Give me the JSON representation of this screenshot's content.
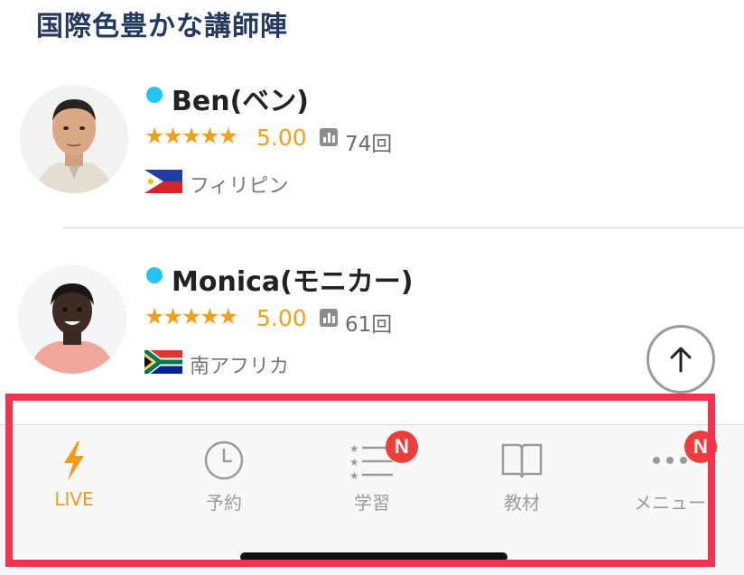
{
  "section_title": "国際色豊かな講師陣",
  "tutors": [
    {
      "name": "Ben(ベン)",
      "online": true,
      "stars": "★★★★★",
      "rating": "5.00",
      "lessons": "74回",
      "country": "フィリピン",
      "flag": "philippines-flag"
    },
    {
      "name": "Monica(モニカー)",
      "online": true,
      "stars": "★★★★★",
      "rating": "5.00",
      "lessons": "61回",
      "country": "南アフリカ",
      "flag": "south-africa-flag"
    }
  ],
  "tabs": [
    {
      "label": "LIVE",
      "icon": "lightning-icon",
      "active": true
    },
    {
      "label": "予約",
      "icon": "clock-icon",
      "active": false
    },
    {
      "label": "学習",
      "icon": "star-list-icon",
      "active": false,
      "badge": "N"
    },
    {
      "label": "教材",
      "icon": "book-icon",
      "active": false
    },
    {
      "label": "メニュー",
      "icon": "more-dots-icon",
      "active": false,
      "badge": "N"
    }
  ],
  "colors": {
    "accent": "#f29a1b",
    "online": "#22c4f2",
    "badge": "#ee3d3a",
    "title": "#233a5e",
    "highlight": "#f4334f"
  }
}
